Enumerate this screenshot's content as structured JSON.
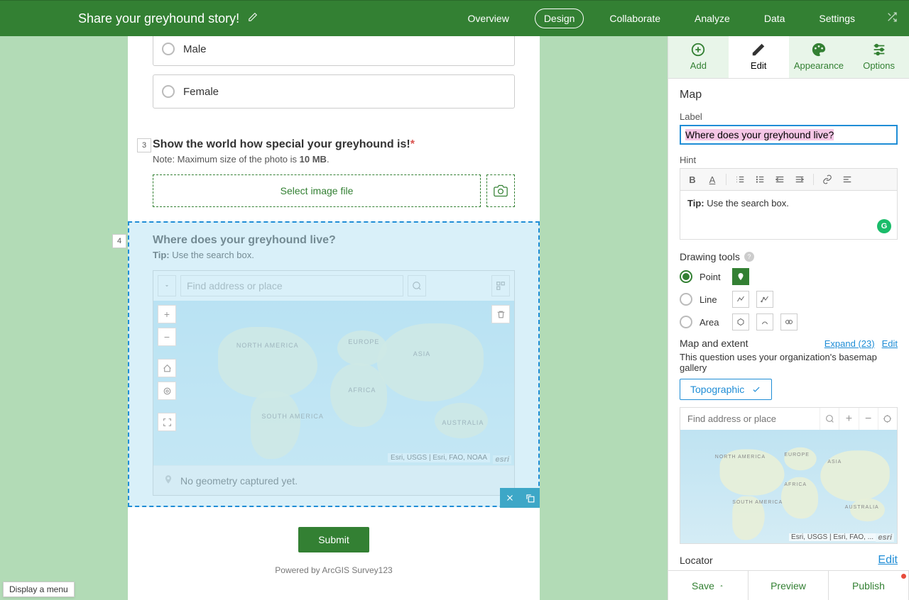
{
  "header": {
    "title": "Share your greyhound story!",
    "nav": {
      "overview": "Overview",
      "design": "Design",
      "collaborate": "Collaborate",
      "analyze": "Analyze",
      "data": "Data",
      "settings": "Settings"
    }
  },
  "survey": {
    "radio_male": "Male",
    "radio_female": "Female",
    "q3_num": "3",
    "q3_title": "Show the world how special your greyhound is!",
    "q3_note_prefix": "Note: Maximum size of the photo is ",
    "q3_note_strong": "10 MB",
    "q3_note_suffix": ".",
    "q3_select_image": "Select image file",
    "q4_num": "4",
    "q4_title": "Where does your greyhound live?",
    "q4_tip_label": "Tip:",
    "q4_tip_text": " Use the search box.",
    "map_search_placeholder": "Find address or place",
    "continents": {
      "na": "NORTH AMERICA",
      "sa": "SOUTH AMERICA",
      "eu": "EUROPE",
      "af": "AFRICA",
      "as": "ASIA",
      "au": "AUSTRALIA"
    },
    "map_attrib": "Esri, USGS | Esri, FAO, NOAA",
    "esri_logo": "esri",
    "no_geom": "No geometry captured yet.",
    "submit": "Submit",
    "powered": "Powered by ArcGIS Survey123"
  },
  "right": {
    "tabs": {
      "add": "Add",
      "edit": "Edit",
      "appearance": "Appearance",
      "options": "Options"
    },
    "section_title": "Map",
    "label_label": "Label",
    "label_value": "Where does your greyhound live?",
    "hint_label": "Hint",
    "hint_tip_strong": "Tip:",
    "hint_tip_text": " Use the search box.",
    "drawing_tools": "Drawing tools",
    "dt_point": "Point",
    "dt_line": "Line",
    "dt_area": "Area",
    "map_extent": "Map and extent",
    "expand": "Expand (23)",
    "edit_link": "Edit",
    "me_desc": "This question uses your organization's basemap gallery",
    "basemap": "Topographic",
    "mini_search_placeholder": "Find address or place",
    "mini_attrib": "Esri, USGS | Esri, FAO, ...",
    "locator": "Locator",
    "footer": {
      "save": "Save",
      "preview": "Preview",
      "publish": "Publish"
    }
  },
  "tooltip": "Display a menu"
}
